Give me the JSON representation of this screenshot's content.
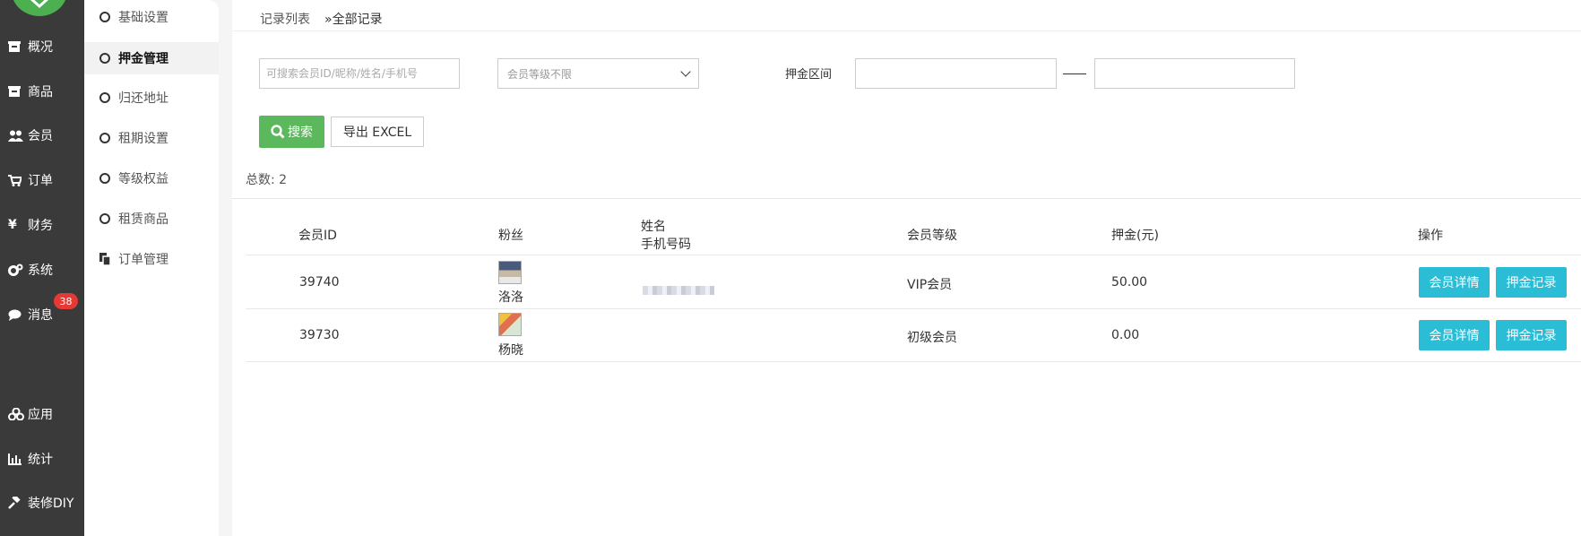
{
  "nav": {
    "items": [
      {
        "label": "概况",
        "icon": "overview-icon"
      },
      {
        "label": "商品",
        "icon": "goods-icon"
      },
      {
        "label": "会员",
        "icon": "members-icon"
      },
      {
        "label": "订单",
        "icon": "cart-icon"
      },
      {
        "label": "财务",
        "icon": "yen-icon"
      },
      {
        "label": "系统",
        "icon": "gears-icon"
      },
      {
        "label": "消息",
        "icon": "comment-icon"
      },
      {
        "label": "应用",
        "icon": "cubes-icon"
      },
      {
        "label": "统计",
        "icon": "bar-chart-icon"
      },
      {
        "label": "装修DIY",
        "icon": "gavel-icon"
      }
    ],
    "message_badge": "38"
  },
  "sub_menu": {
    "items": [
      {
        "label": "基础设置",
        "active": false
      },
      {
        "label": "押金管理",
        "active": true
      },
      {
        "label": "归还地址",
        "active": false
      },
      {
        "label": "租期设置",
        "active": false
      },
      {
        "label": "等级权益",
        "active": false
      },
      {
        "label": "租赁商品",
        "active": false
      },
      {
        "label": "订单管理",
        "active": false
      }
    ]
  },
  "breadcrumb": {
    "first": "记录列表",
    "second": "»全部记录"
  },
  "filters": {
    "search_placeholder": "可搜索会员ID/昵称/姓名/手机号",
    "level_select_value": "会员等级不限",
    "deposit_range_label": "押金区间",
    "search_button": "搜索",
    "export_button": "导出 EXCEL"
  },
  "summary": {
    "total_label": "总数:",
    "total_value": "2"
  },
  "table": {
    "headers": {
      "member_id": "会员ID",
      "fans": "粉丝",
      "name": "姓名",
      "phone": "手机号码",
      "level": "会员等级",
      "deposit": "押金(元)",
      "actions": "操作"
    },
    "rows": [
      {
        "member_id": "39740",
        "fan_name": "洛洛",
        "level": "VIP会员",
        "deposit": "50.00",
        "detail_btn": "会员详情",
        "record_btn": "押金记录"
      },
      {
        "member_id": "39730",
        "fan_name": "杨晓",
        "level": "初级会员",
        "deposit": "0.00",
        "detail_btn": "会员详情",
        "record_btn": "押金记录"
      }
    ]
  },
  "colors": {
    "nav_bg": "#3a3a3a",
    "search_btn": "#5cb85c",
    "action_btn": "#2bbcd6",
    "badge": "#e53935"
  }
}
